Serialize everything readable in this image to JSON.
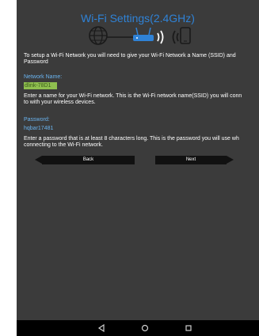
{
  "page": {
    "title": "Wi-Fi Settings(2.4GHz)",
    "intro_line1": "To setup a Wi-Fi Network you will need to give your Wi-Fi Network a Name (SSID) and",
    "intro_line2": "Password"
  },
  "network_name": {
    "label": "Network Name:",
    "value": "dlink-78D1",
    "help_line1": "Enter a name for your Wi-Fi network. This is the Wi-Fi network name(SSID) you will conn",
    "help_line2": "to with your wireless devices."
  },
  "password": {
    "label": "Password:",
    "value": "hqbar17481",
    "help_line1": "Enter a password that is at least 8 characters long. This is the password you will use wh",
    "help_line2": "connecting to the Wi-Fi network."
  },
  "buttons": {
    "back": "Back",
    "next": "Next"
  },
  "nav": {
    "back_icon": "back-triangle-icon",
    "home_icon": "home-circle-icon",
    "recents_icon": "recents-square-icon"
  },
  "colors": {
    "accent": "#2f82d6",
    "label": "#6ab4f0",
    "ssid_highlight": "#8fbf4f",
    "background": "#3b3b3b"
  },
  "icons": [
    "globe-icon",
    "router-icon",
    "wifi-signal-icon",
    "phone-icon"
  ]
}
